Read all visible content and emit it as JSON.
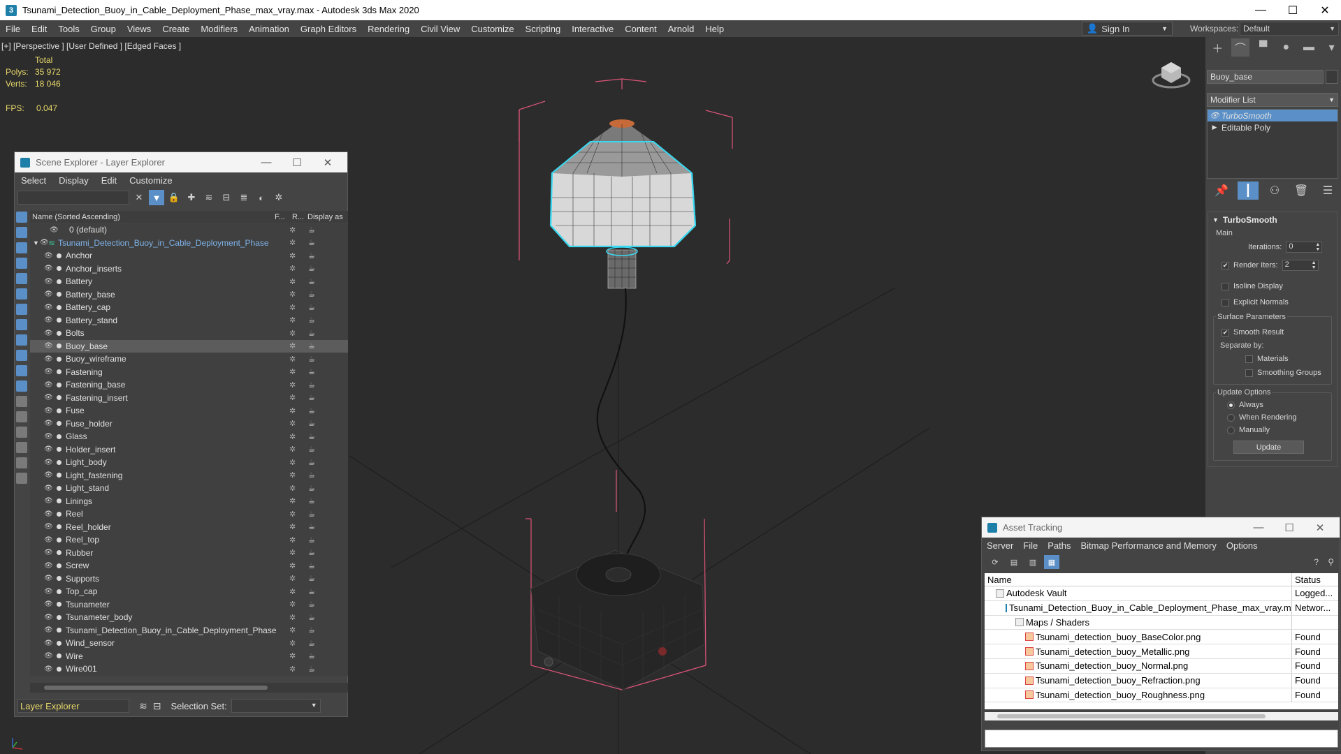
{
  "window": {
    "title": "Tsunami_Detection_Buoy_in_Cable_Deployment_Phase_max_vray.max - Autodesk 3ds Max 2020",
    "minimize": "—",
    "maximize": "☐",
    "close": "✕"
  },
  "menu": [
    "File",
    "Edit",
    "Tools",
    "Group",
    "Views",
    "Create",
    "Modifiers",
    "Animation",
    "Graph Editors",
    "Rendering",
    "Civil View",
    "Customize",
    "Scripting",
    "Interactive",
    "Content",
    "Arnold",
    "Help"
  ],
  "signin": {
    "label": "Sign In"
  },
  "workspace": {
    "label": "Workspaces:",
    "value": "Default"
  },
  "viewport": {
    "label": "[+] [Perspective ] [User Defined ] [Edged Faces ]",
    "stats": {
      "total_label": "Total",
      "polys_label": "Polys:",
      "polys_value": "35 972",
      "verts_label": "Verts:",
      "verts_value": "18 046",
      "fps_label": "FPS:",
      "fps_value": "0.047"
    }
  },
  "command_panel": {
    "tabs": [
      "create",
      "modify",
      "hierarchy",
      "motion",
      "display",
      "utilities"
    ],
    "object_name": "Buoy_base",
    "modifier_list": "Modifier List",
    "stack": [
      "TurboSmooth",
      "Editable Poly"
    ],
    "rollout": {
      "title": "TurboSmooth",
      "main": "Main",
      "iterations_label": "Iterations:",
      "iterations_value": "0",
      "render_iters_label": "Render Iters:",
      "render_iters_value": "2",
      "render_iters_checked": "✔",
      "isoline": "Isoline Display",
      "explicit_normals": "Explicit Normals",
      "surface_params": "Surface Parameters",
      "smooth_result": "Smooth Result",
      "smooth_checked": "✔",
      "separate_by": "Separate by:",
      "materials": "Materials",
      "smoothing_groups": "Smoothing Groups",
      "update_options": "Update Options",
      "always": "Always",
      "when_rendering": "When Rendering",
      "manually": "Manually",
      "update_button": "Update"
    }
  },
  "scene_explorer": {
    "title": "Scene Explorer - Layer Explorer",
    "menu": [
      "Select",
      "Display",
      "Edit",
      "Customize"
    ],
    "columns": {
      "name": "Name (Sorted Ascending)",
      "f": "F...",
      "r": "R...",
      "display": "Display as"
    },
    "default_layer": "0 (default)",
    "main_layer": "Tsunami_Detection_Buoy_in_Cable_Deployment_Phase",
    "items": [
      "Anchor",
      "Anchor_inserts",
      "Battery",
      "Battery_base",
      "Battery_cap",
      "Battery_stand",
      "Bolts",
      "Buoy_base",
      "Buoy_wireframe",
      "Fastening",
      "Fastening_base",
      "Fastening_insert",
      "Fuse",
      "Fuse_holder",
      "Glass",
      "Holder_insert",
      "Light_body",
      "Light_fastening",
      "Light_stand",
      "Linings",
      "Reel",
      "Reel_holder",
      "Reel_top",
      "Rubber",
      "Screw",
      "Supports",
      "Top_cap",
      "Tsunameter",
      "Tsunameter_body",
      "Tsunami_Detection_Buoy_in_Cable_Deployment_Phase",
      "Wind_sensor",
      "Wire",
      "Wire001"
    ],
    "selected": "Buoy_base",
    "explorer_select": "Layer Explorer",
    "selection_set_label": "Selection Set:"
  },
  "asset_tracking": {
    "title": "Asset Tracking",
    "menu": [
      "Server",
      "File",
      "Paths",
      "Bitmap Performance and Memory",
      "Options"
    ],
    "columns": {
      "name": "Name",
      "status": "Status"
    },
    "rows": [
      {
        "name": "Autodesk Vault",
        "status": "Logged...",
        "indent": 0,
        "icon": "vault-icon"
      },
      {
        "name": "Tsunami_Detection_Buoy_in_Cable_Deployment_Phase_max_vray.max",
        "status": "Networ...",
        "indent": 1,
        "icon": "max-file-icon"
      },
      {
        "name": "Maps / Shaders",
        "status": "",
        "indent": 2,
        "icon": "folder-icon"
      },
      {
        "name": "Tsunami_detection_buoy_BaseColor.png",
        "status": "Found",
        "indent": 3,
        "icon": "png-file-icon"
      },
      {
        "name": "Tsunami_detection_buoy_Metallic.png",
        "status": "Found",
        "indent": 3,
        "icon": "png-file-icon"
      },
      {
        "name": "Tsunami_detection_buoy_Normal.png",
        "status": "Found",
        "indent": 3,
        "icon": "png-file-icon"
      },
      {
        "name": "Tsunami_detection_buoy_Refraction.png",
        "status": "Found",
        "indent": 3,
        "icon": "png-file-icon"
      },
      {
        "name": "Tsunami_detection_buoy_Roughness.png",
        "status": "Found",
        "indent": 3,
        "icon": "png-file-icon"
      }
    ]
  },
  "colors": {
    "accent": "#5a8fc7",
    "stats": "#e8d96a",
    "selection_cyan": "#39d7f0",
    "bbox": "#e0557a"
  }
}
